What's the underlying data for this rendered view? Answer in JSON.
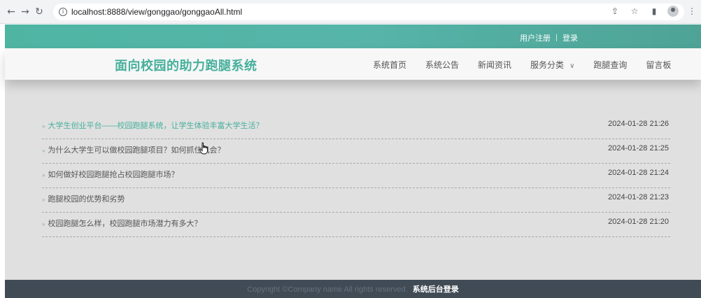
{
  "browser": {
    "url": "localhost:8888/view/gonggao/gonggaoAll.html"
  },
  "topbar": {
    "register": "用户注册",
    "login": "登录"
  },
  "header": {
    "brand": "面向校园的助力跑腿系统",
    "menu": [
      "系统首页",
      "系统公告",
      "新闻资讯",
      "服务分类",
      "跑腿查询",
      "留言板"
    ]
  },
  "notices": [
    {
      "title": "大学生创业平台——校园跑腿系统，让学生体验丰富大学生活？",
      "date": "2024-01-28 21:26"
    },
    {
      "title": "为什么大学生可以做校园跑腿项目？如何抓住机会？",
      "date": "2024-01-28 21:25"
    },
    {
      "title": "如何做好校园跑腿抢占校园跑腿市场？",
      "date": "2024-01-28 21:24"
    },
    {
      "title": "跑腿校园的优势和劣势",
      "date": "2024-01-28 21:23"
    },
    {
      "title": "校园跑腿怎么样，校园跑腿市场潜力有多大？",
      "date": "2024-01-28 21:20"
    }
  ],
  "footer": {
    "copyright": "Copyright ©Company name All rights reserved.",
    "admin_login": "系统后台登录"
  },
  "colors": {
    "accent": "#47b09c",
    "footer_bg": "#404b56"
  }
}
